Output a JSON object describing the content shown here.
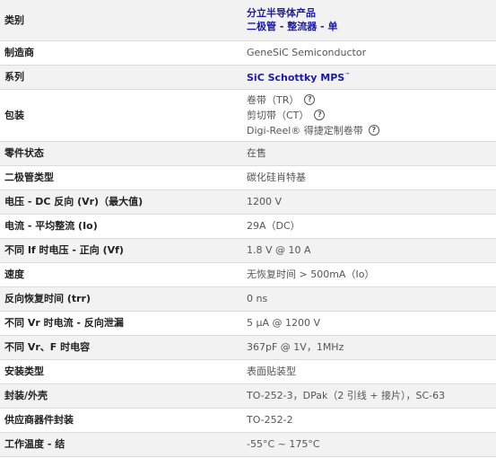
{
  "rows": [
    {
      "label": "类别",
      "value_lines": [
        "分立半导体产品",
        "二极管 - 整流器 - 单"
      ],
      "link": true
    },
    {
      "label": "制造商",
      "value": "GeneSiC Semiconductor"
    },
    {
      "label": "系列",
      "value": "SiC Schottky MPS",
      "tm": "™",
      "link": true
    },
    {
      "label": "包装",
      "packaging": [
        {
          "text": "卷带（TR）",
          "help": "?"
        },
        {
          "text": "剪切带（CT）",
          "help": "?"
        },
        {
          "text": "Digi-Reel® 得捷定制卷带",
          "help": "?"
        }
      ]
    },
    {
      "label": "零件状态",
      "value": "在售"
    },
    {
      "label": "二极管类型",
      "value": "碳化硅肖特基"
    },
    {
      "label": "电压 - DC 反向 (Vr)（最大值)",
      "value": "1200 V"
    },
    {
      "label": "电流 - 平均整流 (Io)",
      "value": "29A（DC）"
    },
    {
      "label": "不同 If 时电压 - 正向 (Vf)",
      "value": "1.8 V @ 10 A"
    },
    {
      "label": "速度",
      "value": "无恢复时间 > 500mA（Io）"
    },
    {
      "label": "反向恢复时间 (trr)",
      "value": "0 ns"
    },
    {
      "label": "不同 Vr 时电流 - 反向泄漏",
      "value": "5 µA @ 1200 V"
    },
    {
      "label": "不同 Vr、F 时电容",
      "value": "367pF @ 1V，1MHz"
    },
    {
      "label": "安装类型",
      "value": "表面贴装型"
    },
    {
      "label": "封装/外壳",
      "value": "TO-252-3，DPak（2 引线 + 接片），SC-63"
    },
    {
      "label": "供应商器件封装",
      "value": "TO-252-2"
    },
    {
      "label": "工作温度 - 结",
      "value": "-55°C ~ 175°C"
    }
  ]
}
